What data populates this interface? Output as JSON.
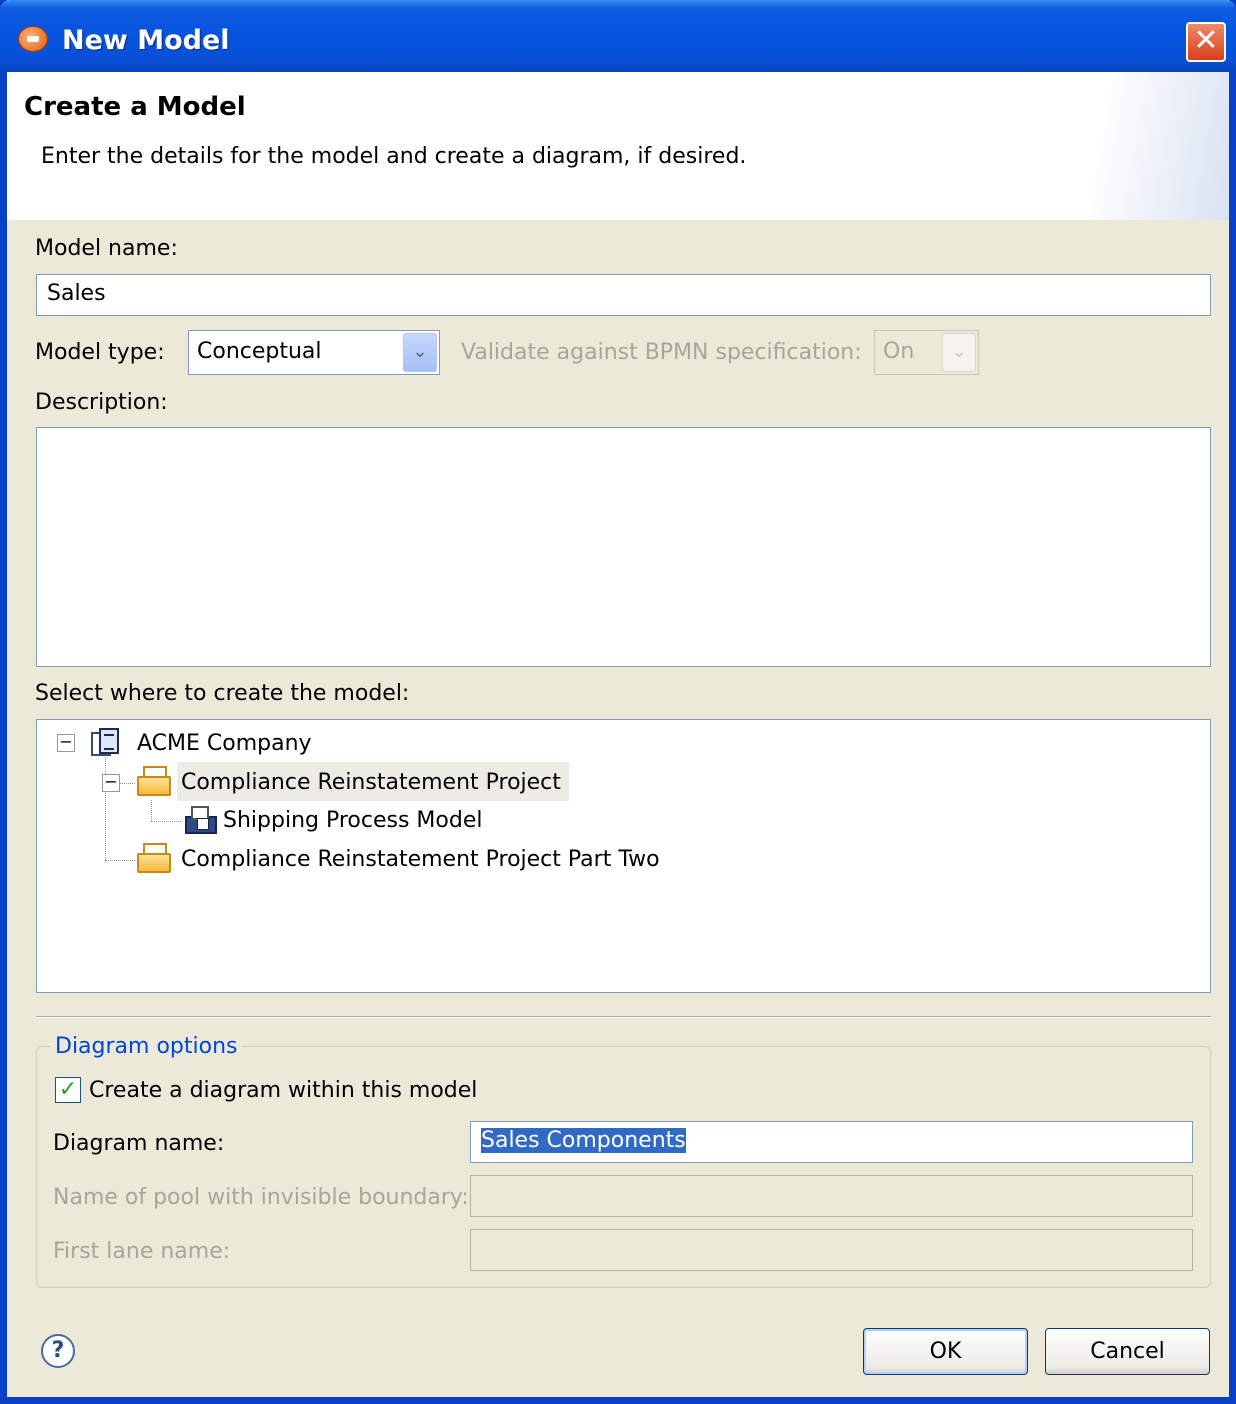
{
  "window": {
    "title": "New Model"
  },
  "header": {
    "title": "Create a Model",
    "description": "Enter the details for the model and create a diagram, if desired."
  },
  "form": {
    "model_name_label": "Model name:",
    "model_name_value": "Sales",
    "model_type_label": "Model type:",
    "model_type_value": "Conceptual",
    "validate_label": "Validate against BPMN specification:",
    "validate_value": "On",
    "description_label": "Description:",
    "description_value": "",
    "location_label": "Select where to create the model:"
  },
  "tree": {
    "items": [
      {
        "label": "ACME Company",
        "icon": "company-icon",
        "expanded": true
      },
      {
        "label": "Compliance Reinstatement Project",
        "icon": "folder-icon",
        "expanded": true,
        "selected": true
      },
      {
        "label": "Shipping Process Model",
        "icon": "model-icon"
      },
      {
        "label": "Compliance Reinstatement Project Part Two",
        "icon": "folder-icon"
      }
    ]
  },
  "diagram_options": {
    "group_title": "Diagram options",
    "create_checkbox_label": "Create a diagram within this model",
    "create_checked": true,
    "diagram_name_label": "Diagram name:",
    "diagram_name_value": "Sales Components",
    "pool_label": "Name of pool with invisible boundary:",
    "pool_value": "",
    "lane_label": "First lane name:",
    "lane_value": ""
  },
  "buttons": {
    "ok": "OK",
    "cancel": "Cancel"
  },
  "colors": {
    "titlebar": "#0654e0",
    "group_title": "#0046d5",
    "selection": "#316ac5",
    "dialog_bg": "#ece9d8"
  }
}
